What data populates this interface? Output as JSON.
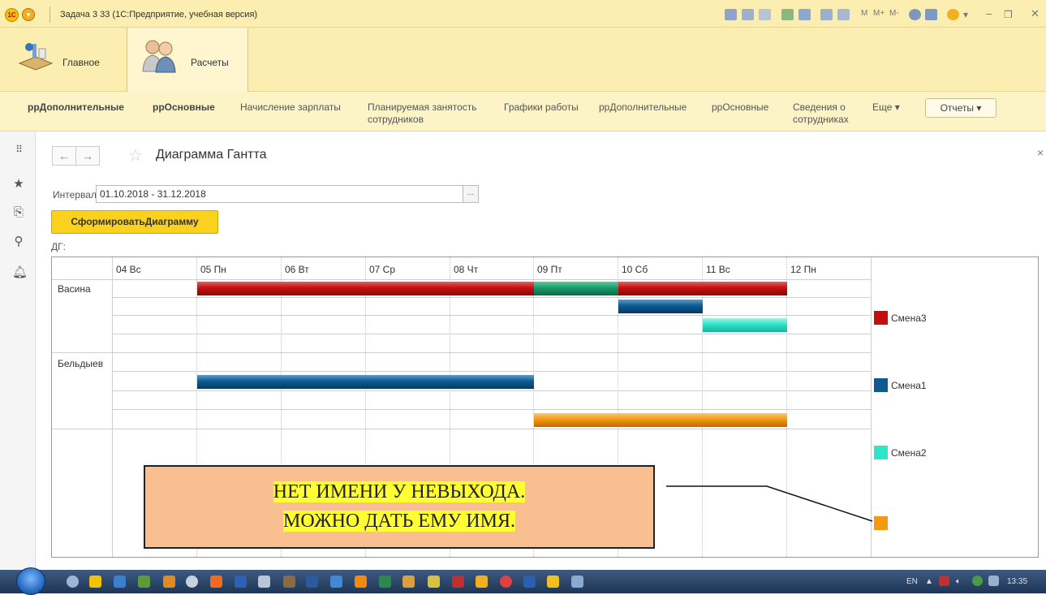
{
  "window": {
    "title": "Задача 3 33 (1С:Предприятие, учебная версия)"
  },
  "toolbar_right": {
    "m": "M",
    "mplus": "M+",
    "mminus": "M-"
  },
  "sections": [
    {
      "label": "Главное"
    },
    {
      "label": "Расчеты"
    }
  ],
  "func_panel": {
    "items": [
      {
        "label": "ррДополнительные",
        "bold": true
      },
      {
        "label": "ррОсновные",
        "bold": true
      },
      {
        "label": "Начисление зарплаты"
      },
      {
        "label": "Планируемая занятость",
        "label2": "сотрудников"
      },
      {
        "label": "Графики работы"
      },
      {
        "label": "ррДополнительные"
      },
      {
        "label": "ррОсновные"
      },
      {
        "label": "Сведения о",
        "label2": "сотрудниках"
      }
    ],
    "more": "Еще ▾",
    "reports": "Отчеты ▾"
  },
  "form": {
    "title": "Диаграмма Гантта",
    "interval_label": "Интервал:",
    "interval_value": "01.10.2018 - 31.12.2018",
    "choose": "...",
    "generate_button": "СформироватьДиаграмму",
    "dg_label": "ДГ:"
  },
  "gantt": {
    "days": [
      "04 Вс",
      "05 Пн",
      "06 Вт",
      "07 Ср",
      "08 Чт",
      "09 Пт",
      "10 Сб",
      "11 Вс",
      "12 Пн"
    ],
    "resources": [
      "Васина",
      "Бельдыев"
    ],
    "series": [
      {
        "name": "Смена3",
        "color": "#c50f0f"
      },
      {
        "name": "Смена1",
        "color": "#0e5a91"
      },
      {
        "name": "Смена2",
        "color": "#2fe4c8"
      },
      {
        "name": "",
        "color": "#f39a12"
      }
    ],
    "intervals": [
      {
        "resource": "Васина",
        "row": 0,
        "start": "05",
        "end": "09",
        "series": "Смена3"
      },
      {
        "resource": "Васина",
        "row": 0,
        "start": "09",
        "end": "10",
        "series": "green"
      },
      {
        "resource": "Васина",
        "row": 0,
        "start": "10",
        "end": "12",
        "series": "Смена3"
      },
      {
        "resource": "Васина",
        "row": 1,
        "start": "10",
        "end": "11",
        "series": "Смена1"
      },
      {
        "resource": "Васина",
        "row": 2,
        "start": "11",
        "end": "12",
        "series": "Смена2"
      },
      {
        "resource": "Бельдыев",
        "row": 1,
        "start": "05",
        "end": "09",
        "series": "Смена1"
      },
      {
        "resource": "Бельдыев",
        "row": 3,
        "start": "09",
        "end": "12",
        "series": "unnamed"
      }
    ],
    "green_color": "#1a9a6b"
  },
  "callout": {
    "line1": "НЕТ ИМЕНИ У НЕВЫХОДА.",
    "line2": "МОЖНО ДАТЬ ЕМУ ИМЯ."
  },
  "taskbar": {
    "lang": "EN",
    "time": "13:35"
  }
}
